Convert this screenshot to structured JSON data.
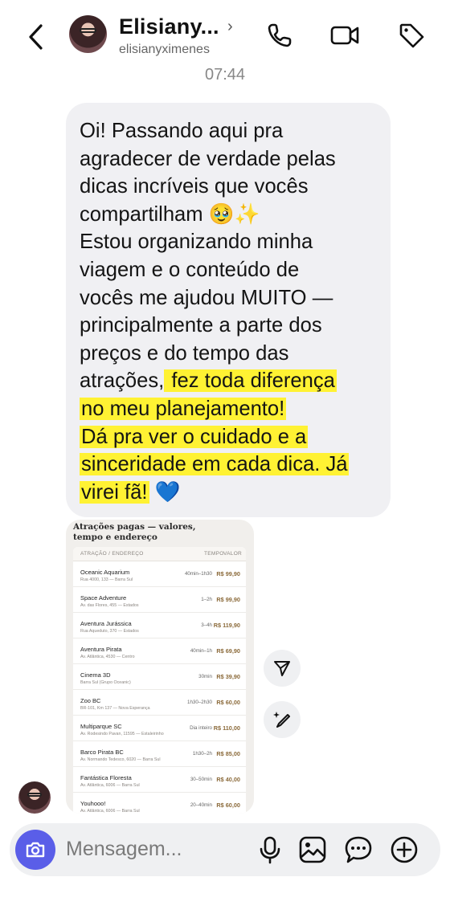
{
  "header": {
    "contact_name": "Elisiany...",
    "handle": "elisianyximenes",
    "icons": [
      "back-arrow",
      "phone-icon",
      "video-icon",
      "tag-icon"
    ]
  },
  "timestamp": "07:44",
  "message": {
    "lines": [
      {
        "text": "Oi! Passando aqui pra"
      },
      {
        "text": "agradecer de verdade pelas"
      },
      {
        "text": "dicas incríveis que vocês"
      },
      {
        "text": "compartilham 🥹✨"
      },
      {
        "text": "Estou organizando minha"
      },
      {
        "text": "viagem e o conteúdo de"
      },
      {
        "text": "vocês me ajudou MUITO —"
      },
      {
        "text": "principalmente a parte dos"
      },
      {
        "text": "preços e do tempo das"
      },
      {
        "text": "atrações,",
        "highlight": " fez toda diferença"
      },
      {
        "text": "",
        "highlight": "no meu planejamento!"
      },
      {
        "text": "",
        "highlight": "Dá pra ver o cuidado e a"
      },
      {
        "text": "",
        "highlight": "sinceridade em cada dica. Já"
      },
      {
        "text": "",
        "highlight": "virei fã!",
        "tail": " 💙"
      }
    ],
    "highlight_color": "#fff233"
  },
  "attachment": {
    "title": "Atrações pagas — valores, tempo e endereço",
    "columns": {
      "name": "ATRAÇÃO / ENDEREÇO",
      "time": "TEMPO",
      "price": "VALOR"
    },
    "rows": [
      {
        "name": "Oceanic Aquarium",
        "address": "Rua 4000, 133 — Barra Sul",
        "time": "40min–1h30",
        "price": "R$ 99,90"
      },
      {
        "name": "Space Adventure",
        "address": "Av. das Flores, 455 — Estados",
        "time": "1–2h",
        "price": "R$ 99,90"
      },
      {
        "name": "Aventura Jurássica",
        "address": "Rua Aqueduto, 370 — Estados",
        "time": "3–4h",
        "price": "R$ 119,90"
      },
      {
        "name": "Aventura Pirata",
        "address": "Av. Atlântica, 4530 — Centro",
        "time": "40min–1h",
        "price": "R$ 69,90"
      },
      {
        "name": "Cinema 3D",
        "address": "Barra Sul (Grupo Oceanic)",
        "time": "30min",
        "price": "R$ 39,90"
      },
      {
        "name": "Zoo BC",
        "address": "BR-101, Km 137 — Nova Esperança",
        "time": "1h30–2h30",
        "price": "R$ 60,00"
      },
      {
        "name": "Multiparque SC",
        "address": "Av. Rodesindo Pavan, 11595 — Estaleirinho",
        "time": "Dia inteiro",
        "price": "R$ 110,00"
      },
      {
        "name": "Barco Pirata BC",
        "address": "Av. Normando Tedesco, 6020 — Barra Sul",
        "time": "1h30–2h",
        "price": "R$ 85,00"
      },
      {
        "name": "Fantástica Floresta",
        "address": "Av. Atlântica, 6006 — Barra Sul",
        "time": "30–50min",
        "price": "R$ 40,00"
      },
      {
        "name": "Youhooo!",
        "address": "Av. Atlântica, 6006 — Barra Sul",
        "time": "20–40min",
        "price": "R$ 60,00"
      }
    ]
  },
  "side_actions": [
    "share-icon",
    "ai-edit-icon"
  ],
  "composer": {
    "placeholder": "Mensagem...",
    "icons": [
      "camera-icon",
      "microphone-icon",
      "gallery-icon",
      "sticker-icon",
      "add-icon"
    ],
    "accent": "#5a5ee8"
  }
}
